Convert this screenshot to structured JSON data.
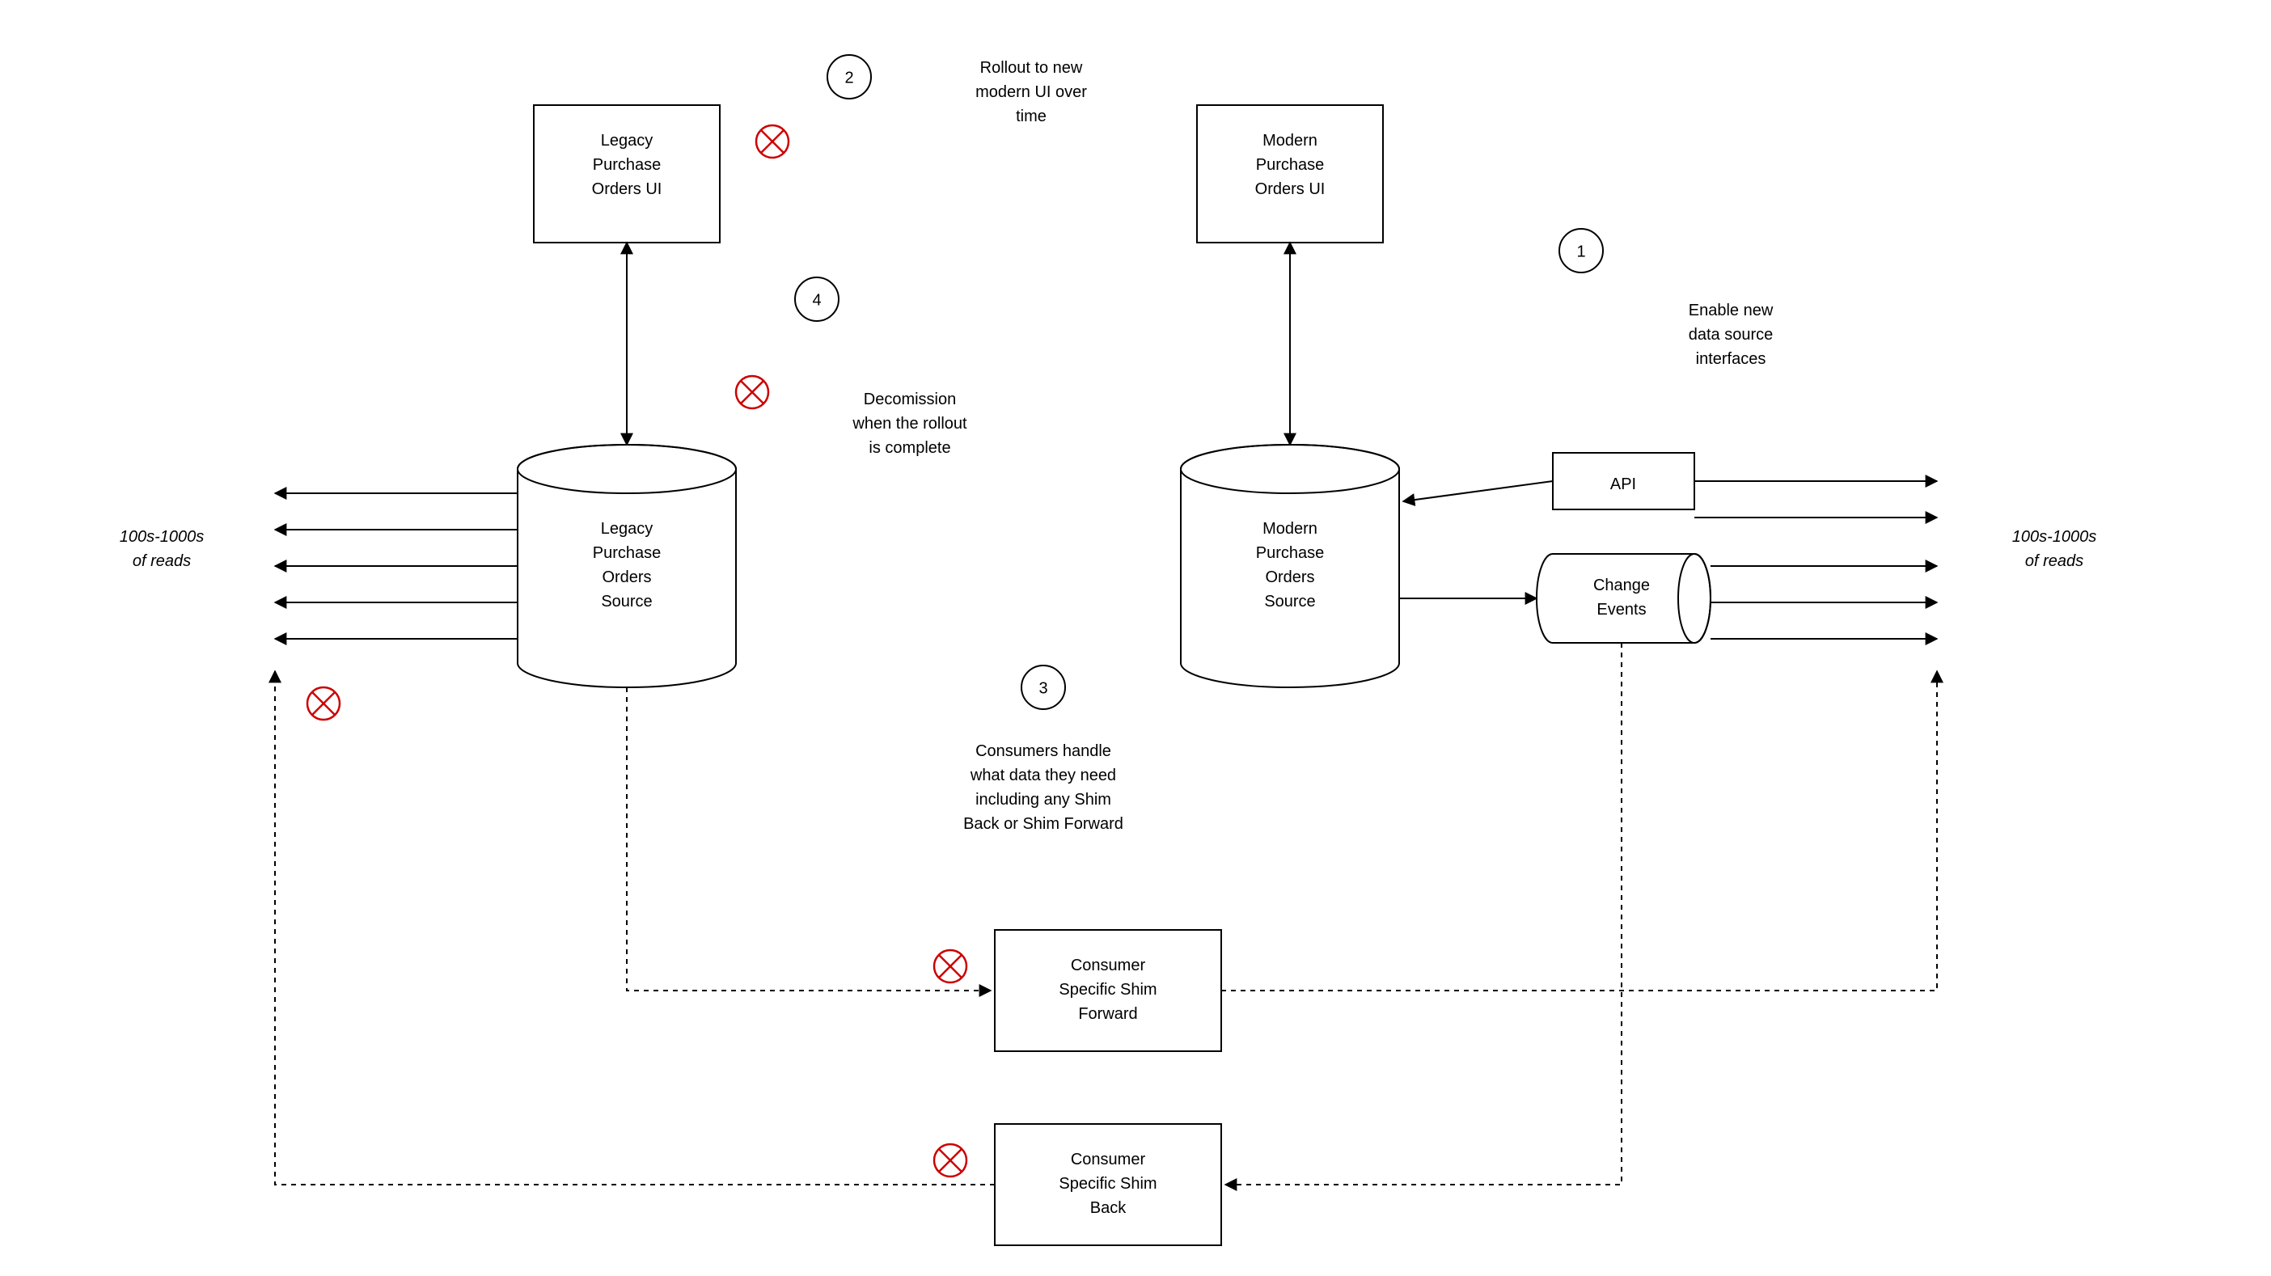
{
  "boxes": {
    "legacy_ui": "Legacy\nPurchase\nOrders UI",
    "modern_ui": "Modern\nPurchase\nOrders UI",
    "legacy_source": "Legacy\nPurchase\nOrders\nSource",
    "modern_source": "Modern\nPurchase\nOrders\nSource",
    "api": "API",
    "change_events": "Change\nEvents",
    "shim_forward": "Consumer\nSpecific Shim\nForward",
    "shim_back": "Consumer\nSpecific Shim\nBack"
  },
  "steps": {
    "1": {
      "num": "1",
      "text": "Enable new\ndata source\ninterfaces"
    },
    "2": {
      "num": "2",
      "text": "Rollout to new\nmodern UI over\ntime"
    },
    "3": {
      "num": "3",
      "text": "Consumers handle\nwhat data they need\nincluding any Shim\nBack or Shim Forward"
    },
    "4": {
      "num": "4",
      "text": "Decomission\nwhen the rollout\nis complete"
    }
  },
  "reads_left": "100s-1000s\nof reads",
  "reads_right": "100s-1000s\nof reads"
}
